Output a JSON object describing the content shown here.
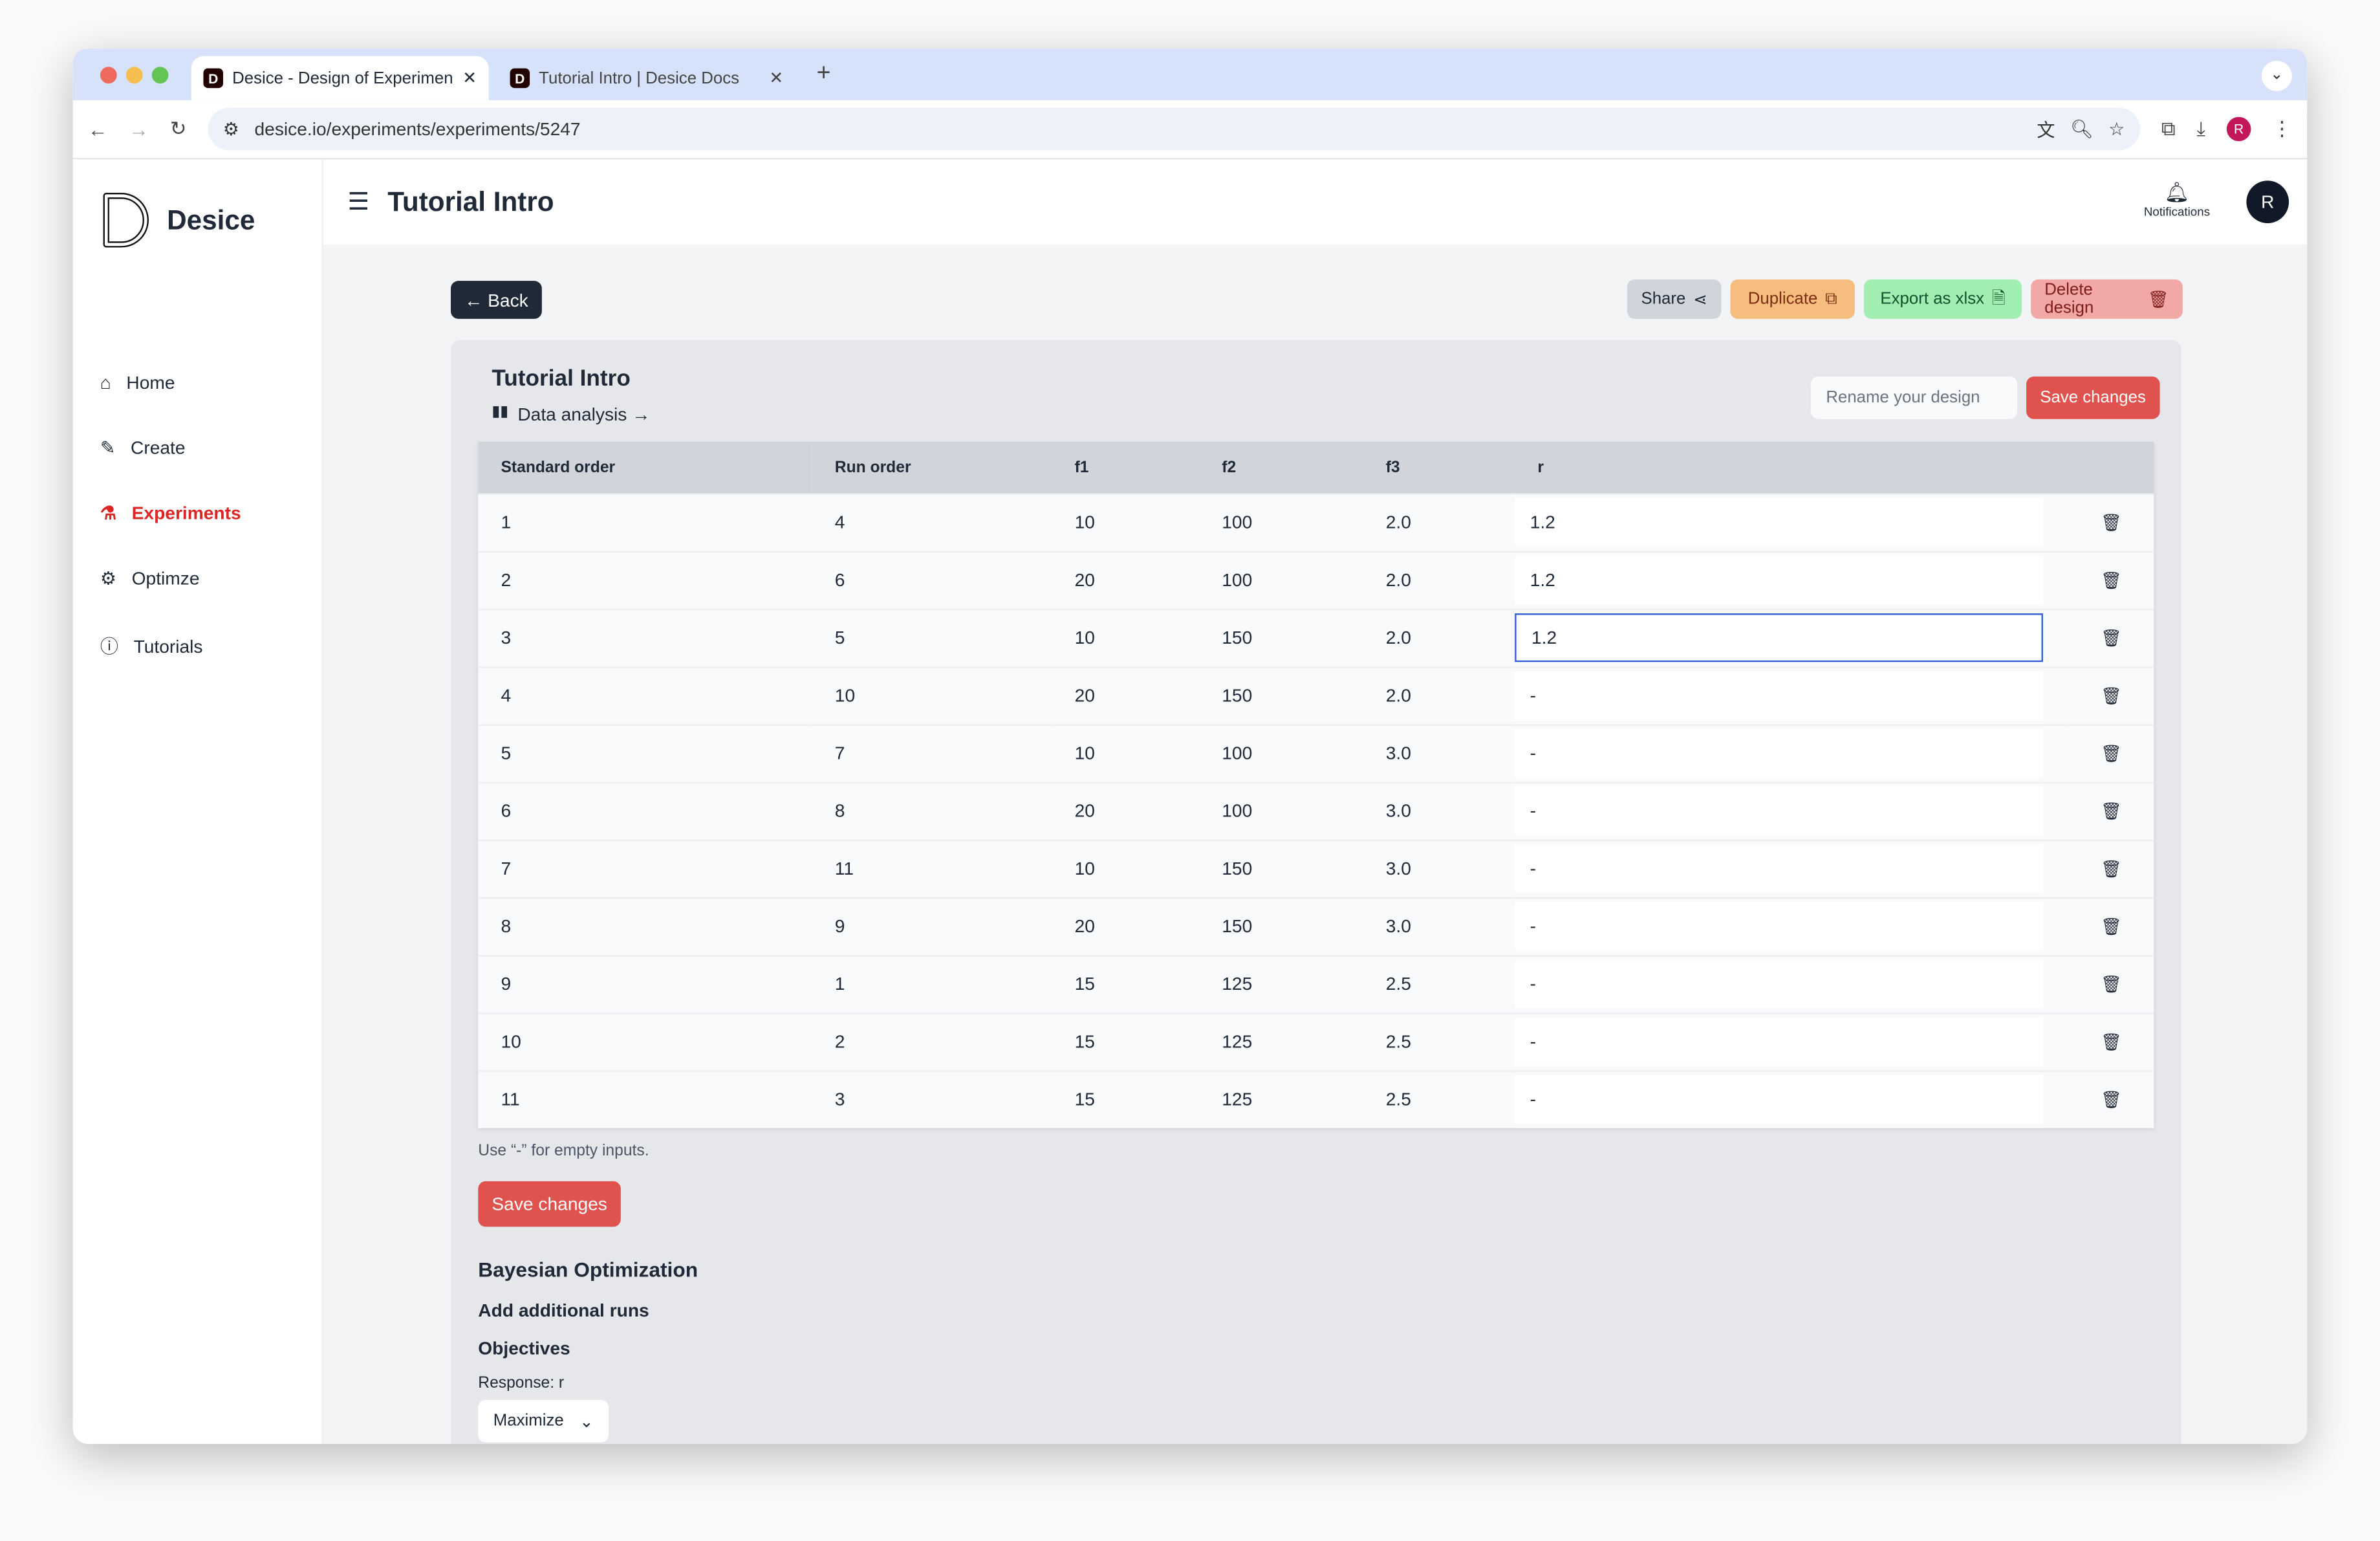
{
  "browser": {
    "tabs": [
      {
        "title": "Desice - Design of Experimen",
        "favicon": "D"
      },
      {
        "title": "Tutorial Intro | Desice Docs",
        "favicon": "D"
      }
    ],
    "url": "desice.io/experiments/experiments/5247",
    "profile": "R"
  },
  "app": {
    "brand": "Desice",
    "page_title": "Tutorial Intro",
    "notifications_label": "Notifications",
    "avatar": "R",
    "sidebar": [
      {
        "label": "Home",
        "icon": "home-icon"
      },
      {
        "label": "Create",
        "icon": "pencil-icon"
      },
      {
        "label": "Experiments",
        "icon": "flask-icon",
        "active": true
      },
      {
        "label": "Optimze",
        "icon": "gear-icon"
      },
      {
        "label": "Tutorials",
        "icon": "info-icon"
      }
    ]
  },
  "actions": {
    "back": "← Back",
    "share": "Share",
    "duplicate": "Duplicate",
    "export": "Export as xlsx",
    "delete": "Delete design"
  },
  "colors": {
    "accent": "#dc2626",
    "save": "#e0524d",
    "share": "#d1d5db",
    "duplicate": "#f5be7e",
    "export": "#a2edb2",
    "delete": "#f1a8a6"
  },
  "design": {
    "title": "Tutorial Intro",
    "data_analysis": "Data analysis →",
    "rename_placeholder": "Rename your design",
    "save": "Save changes",
    "columns": [
      "Standard order",
      "Run order",
      "f1",
      "f2",
      "f3",
      "r"
    ],
    "rows": [
      [
        "1",
        "4",
        "10",
        "100",
        "2.0",
        "1.2"
      ],
      [
        "2",
        "6",
        "20",
        "100",
        "2.0",
        "1.2"
      ],
      [
        "3",
        "5",
        "10",
        "150",
        "2.0",
        "1.2"
      ],
      [
        "4",
        "10",
        "20",
        "150",
        "2.0",
        "-"
      ],
      [
        "5",
        "7",
        "10",
        "100",
        "3.0",
        "-"
      ],
      [
        "6",
        "8",
        "20",
        "100",
        "3.0",
        "-"
      ],
      [
        "7",
        "11",
        "10",
        "150",
        "3.0",
        "-"
      ],
      [
        "8",
        "9",
        "20",
        "150",
        "3.0",
        "-"
      ],
      [
        "9",
        "1",
        "15",
        "125",
        "2.5",
        "-"
      ],
      [
        "10",
        "2",
        "15",
        "125",
        "2.5",
        "-"
      ],
      [
        "11",
        "3",
        "15",
        "125",
        "2.5",
        "-"
      ]
    ],
    "hint": "Use “-” for empty inputs.",
    "save_bottom": "Save changes"
  },
  "bayes": {
    "title": "Bayesian Optimization",
    "add_runs": "Add additional runs",
    "objectives": "Objectives",
    "response": "Response: r",
    "goal": "Maximize"
  }
}
